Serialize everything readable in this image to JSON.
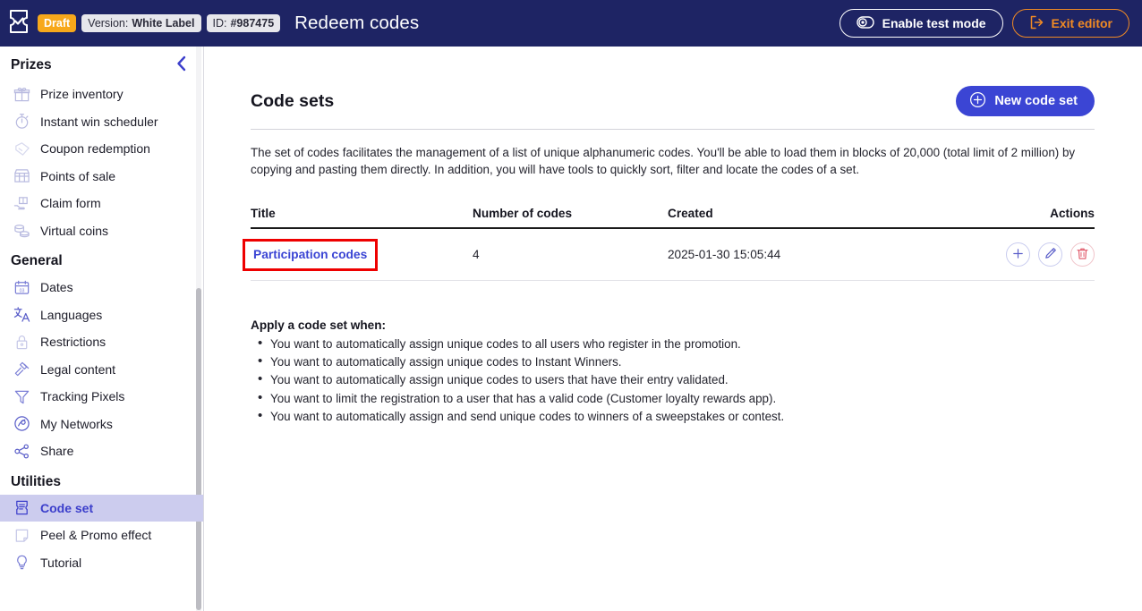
{
  "topbar": {
    "logo_icon": "ticket-check-icon",
    "status_badge": "Draft",
    "version_badge_label": "Version:",
    "version_badge_value": "White Label",
    "id_badge_label": "ID:",
    "id_badge_value": "#987475",
    "page_title": "Redeem codes",
    "test_mode_label": "Enable test mode",
    "test_mode_icon": "toggle-icon",
    "exit_editor_label": "Exit editor",
    "exit_editor_icon": "exit-arrow-icon",
    "bg_color": "#1e2464",
    "draft_color": "#f7a81b",
    "exit_color": "#f08a24"
  },
  "sidebar": {
    "collapse_icon": "chevron-left-icon",
    "groups": [
      {
        "title": "Prizes",
        "items": [
          {
            "label": "Prize inventory",
            "icon": "gift-icon",
            "active": false
          },
          {
            "label": "Instant win scheduler",
            "icon": "stopwatch-icon",
            "active": false
          },
          {
            "label": "Coupon redemption",
            "icon": "coupon-icon",
            "active": false
          },
          {
            "label": "Points of sale",
            "icon": "storefront-icon",
            "active": false
          },
          {
            "label": "Claim form",
            "icon": "hand-gift-icon",
            "active": false
          },
          {
            "label": "Virtual coins",
            "icon": "coins-icon",
            "active": false
          }
        ]
      },
      {
        "title": "General",
        "items": [
          {
            "label": "Dates",
            "icon": "calendar-icon",
            "active": false
          },
          {
            "label": "Languages",
            "icon": "translate-icon",
            "active": false
          },
          {
            "label": "Restrictions",
            "icon": "lock-icon",
            "active": false
          },
          {
            "label": "Legal content",
            "icon": "gavel-icon",
            "active": false
          },
          {
            "label": "Tracking Pixels",
            "icon": "funnel-icon",
            "active": false
          },
          {
            "label": "My Networks",
            "icon": "network-icon",
            "active": false
          },
          {
            "label": "Share",
            "icon": "share-icon",
            "active": false
          }
        ]
      },
      {
        "title": "Utilities",
        "items": [
          {
            "label": "Code set",
            "icon": "ticket-code-icon",
            "active": true
          },
          {
            "label": "Peel & Promo effect",
            "icon": "peel-icon",
            "active": false
          },
          {
            "label": "Tutorial",
            "icon": "lightbulb-icon",
            "active": false
          }
        ]
      }
    ],
    "active_bg": "#ccccee",
    "active_text": "#3b3ecb"
  },
  "main": {
    "section_title": "Code sets",
    "new_button_label": "New code set",
    "new_button_icon": "plus-circle-icon",
    "new_button_color": "#3b45d4",
    "description": "The set of codes facilitates the management of a list of unique alphanumeric codes. You'll be able to load them in blocks of 20,000 (total limit of 2 million) by copying and pasting them directly. In addition, you will have tools to quickly sort, filter and locate the codes of a set.",
    "table": {
      "columns": [
        "Title",
        "Number of codes",
        "Created",
        "Actions"
      ],
      "rows": [
        {
          "title": "Participation codes",
          "number_of_codes": "4",
          "created": "2025-01-30 15:05:44",
          "highlighted": true,
          "actions": [
            {
              "icon": "plus-circle-icon",
              "name": "add-codes-button"
            },
            {
              "icon": "pencil-icon",
              "name": "edit-code-set-button"
            },
            {
              "icon": "trash-icon",
              "name": "delete-code-set-button"
            }
          ]
        }
      ],
      "highlight_color": "#ee0000"
    },
    "apply": {
      "title": "Apply a code set when:",
      "items": [
        "You want to automatically assign unique codes to all users who register in the promotion.",
        "You want to automatically assign unique codes to Instant Winners.",
        "You want to automatically assign unique codes to users that have their entry validated.",
        "You want to limit the registration to a user that has a valid code (Customer loyalty rewards app).",
        "You want to automatically assign and send unique codes to winners of a sweepstakes or contest."
      ]
    }
  }
}
